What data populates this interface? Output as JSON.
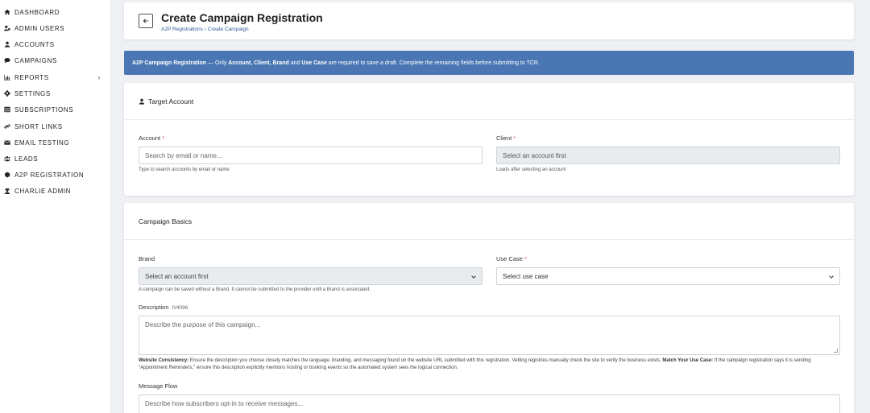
{
  "sidebar": {
    "items": [
      {
        "label": "DASHBOARD",
        "icon": "home-icon"
      },
      {
        "label": "ADMIN USERS",
        "icon": "users-cog-icon"
      },
      {
        "label": "ACCOUNTS",
        "icon": "user-icon"
      },
      {
        "label": "CAMPAIGNS",
        "icon": "comment-icon"
      },
      {
        "label": "REPORTS",
        "icon": "chart-bar-icon",
        "chevron": "›"
      },
      {
        "label": "SETTINGS",
        "icon": "gear-icon"
      },
      {
        "label": "SUBSCRIPTIONS",
        "icon": "list-icon"
      },
      {
        "label": "SHORT LINKS",
        "icon": "link-icon"
      },
      {
        "label": "EMAIL TESTING",
        "icon": "envelope-icon"
      },
      {
        "label": "LEADS",
        "icon": "users-icon"
      },
      {
        "label": "A2P REGISTRATION",
        "icon": "gear-badge-icon"
      },
      {
        "label": "CHARLIE ADMIN",
        "icon": "user-secret-icon"
      }
    ]
  },
  "header": {
    "title": "Create Campaign Registration",
    "breadcrumb": "A2P Registrations › Create Campaign"
  },
  "banner": {
    "lead": "A2P Campaign Registration",
    "t1": " — Only ",
    "b1": "Account, Client, Brand",
    "t2": " and ",
    "b2": "Use Case",
    "t3": " are required to save a draft. Complete the remaining fields before submitting to TCR.",
    "color": "#4a77b4"
  },
  "target": {
    "title": "Target Account",
    "account_label": "Account",
    "account_placeholder": "Search by email or name...",
    "account_help": "Type to search accounts by email or name",
    "client_label": "Client",
    "client_value": "Select an account first",
    "client_help": "Loads after selecting an account",
    "required_mark": "*"
  },
  "basics": {
    "title": "Campaign Basics",
    "brand_label": "Brand",
    "brand_value": "Select an account first",
    "brand_help": "A campaign can be saved without a Brand. It cannot be submitted to the provider until a Brand is associated.",
    "usecase_label": "Use Case",
    "usecase_value": "Select use case",
    "description_label": "Description",
    "description_count": "0/4096",
    "description_placeholder": "Describe the purpose of this campaign...",
    "note_b1": "Website Consistency:",
    "note_t1": " Ensure the description you choose closely matches the language, branding, and messaging found on the website URL submitted with this registration. Vetting registries manually check the site to verify the business exists. ",
    "note_b2": "Match Your Use Case:",
    "note_t2": " If the campaign registration says it is sending \"Appointment Reminders,\" ensure this description explicitly mentions hosting or booking events so the automated system sees the logical connection.",
    "message_flow_label": "Message Flow",
    "message_flow_placeholder": "Describe how subscribers opt-in to receive messages..."
  }
}
